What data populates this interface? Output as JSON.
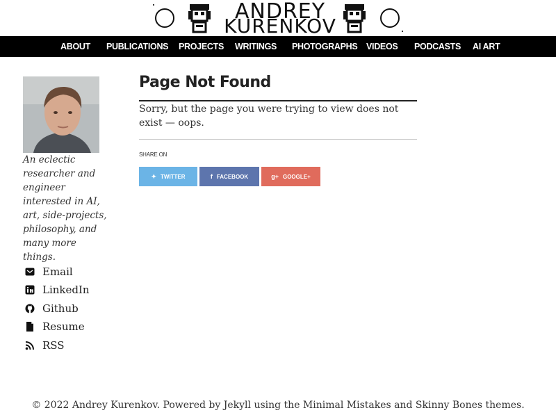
{
  "logo": {
    "line1": "ANDREY",
    "line2": "KURENKOV"
  },
  "nav": {
    "items": [
      {
        "label": "ABOUT"
      },
      {
        "label": "PUBLICATIONS"
      },
      {
        "label": "PROJECTS"
      },
      {
        "label": "WRITINGS"
      },
      {
        "label": "PHOTOGRAPHS"
      },
      {
        "label": "VIDEOS"
      },
      {
        "label": "PODCASTS"
      },
      {
        "label": "AI ART"
      }
    ]
  },
  "sidebar": {
    "bio": "An eclectic researcher and engineer interested in AI, art, side-projects, philosophy, and many more things.",
    "links": [
      {
        "label": "Email",
        "icon": "email-icon"
      },
      {
        "label": "LinkedIn",
        "icon": "linkedin-icon"
      },
      {
        "label": "Github",
        "icon": "github-icon"
      },
      {
        "label": "Resume",
        "icon": "file-icon"
      },
      {
        "label": "RSS",
        "icon": "rss-icon"
      }
    ]
  },
  "main": {
    "title": "Page Not Found",
    "message": "Sorry, but the page you were trying to view does not exist — oops.",
    "share_label": "SHARE ON",
    "share": [
      {
        "label": "TWITTER",
        "icon": "twitter-icon",
        "color": "#6bb4e6"
      },
      {
        "label": "FACEBOOK",
        "icon": "facebook-icon",
        "color": "#5d75ad"
      },
      {
        "label": "GOOGLE+",
        "icon": "google-plus-icon",
        "color": "#e06b5c"
      }
    ]
  },
  "footer": {
    "text": "© 2022 Andrey Kurenkov. Powered by Jekyll using the Minimal Mistakes and Skinny Bones themes."
  }
}
